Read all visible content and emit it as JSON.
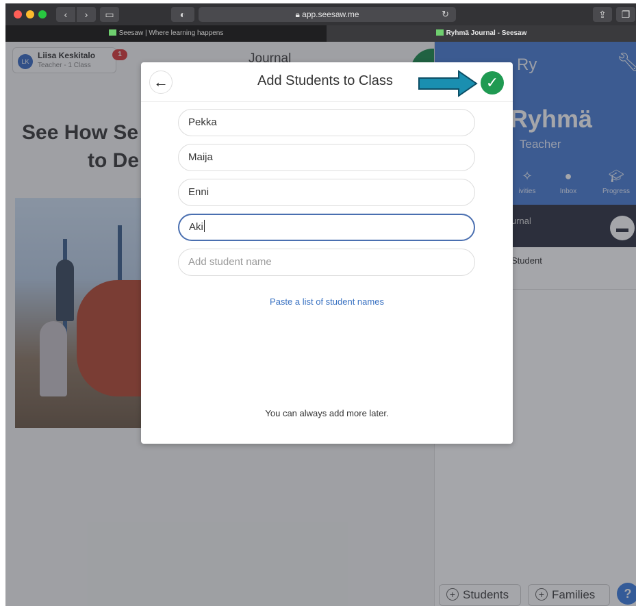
{
  "browser": {
    "address": "app.seesaw.me",
    "tabs": [
      {
        "label": "Seesaw | Where learning happens"
      },
      {
        "label": "Ryhmä Journal - Seesaw"
      }
    ]
  },
  "user": {
    "initials": "LK",
    "name": "Liisa Keskitalo",
    "subtitle": "Teacher - 1 Class",
    "notifications": "1"
  },
  "journal_title": "Journal",
  "promo": {
    "line1": "See How Se",
    "line2": "to De"
  },
  "class_panel": {
    "tab_label": "Ry",
    "class_name": "Ryhmä",
    "role": "Teacher",
    "nav": [
      {
        "label": "ivities",
        "icon": "bulb-icon"
      },
      {
        "label": "Inbox",
        "icon": "chat-bubbles-icon"
      },
      {
        "label": "Progress",
        "icon": "graduation-cap-icon"
      }
    ],
    "journal_label": "urnal",
    "student_label": "Student",
    "add_students_label": "Students",
    "add_families_label": "Families",
    "help_label": "?"
  },
  "modal": {
    "title": "Add Students to Class",
    "students": [
      "Pekka",
      "Maija",
      "Enni",
      "Aki"
    ],
    "new_student_placeholder": "Add student name",
    "paste_link": "Paste a list of student names",
    "note": "You can always add more later."
  },
  "colors": {
    "accent_green": "#1f9a52",
    "class_blue": "#4a7fd4",
    "arrow_teal": "#1a8fb0",
    "link_blue": "#3a72c2"
  }
}
